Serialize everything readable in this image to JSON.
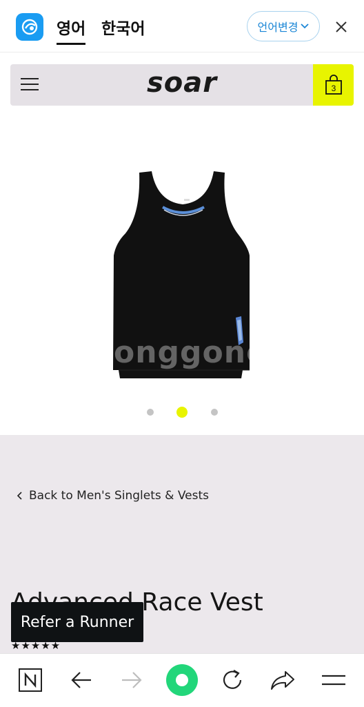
{
  "translator": {
    "tab_english": "영어",
    "tab_korean": "한국어",
    "change_language": "언어변경"
  },
  "site": {
    "logo": "soar",
    "cart_count": "3"
  },
  "product": {
    "watermark": "onggonc",
    "carousel_active_index": 1,
    "carousel_count": 3,
    "back_link": "Back to Men's Singlets & Vests",
    "title": "Advanced Race Vest",
    "refer_button": "Refer a Runner",
    "rating_stars": "★★★★★"
  },
  "colors": {
    "accent_yellow": "#e8f400",
    "translator_blue": "#1a9cf2",
    "nav_green": "#22d67a"
  },
  "browser_nav": {
    "icons": [
      "naver-n-icon",
      "back-arrow-icon",
      "forward-arrow-icon",
      "home-circle-icon",
      "refresh-icon",
      "share-icon",
      "menu-icon"
    ]
  }
}
